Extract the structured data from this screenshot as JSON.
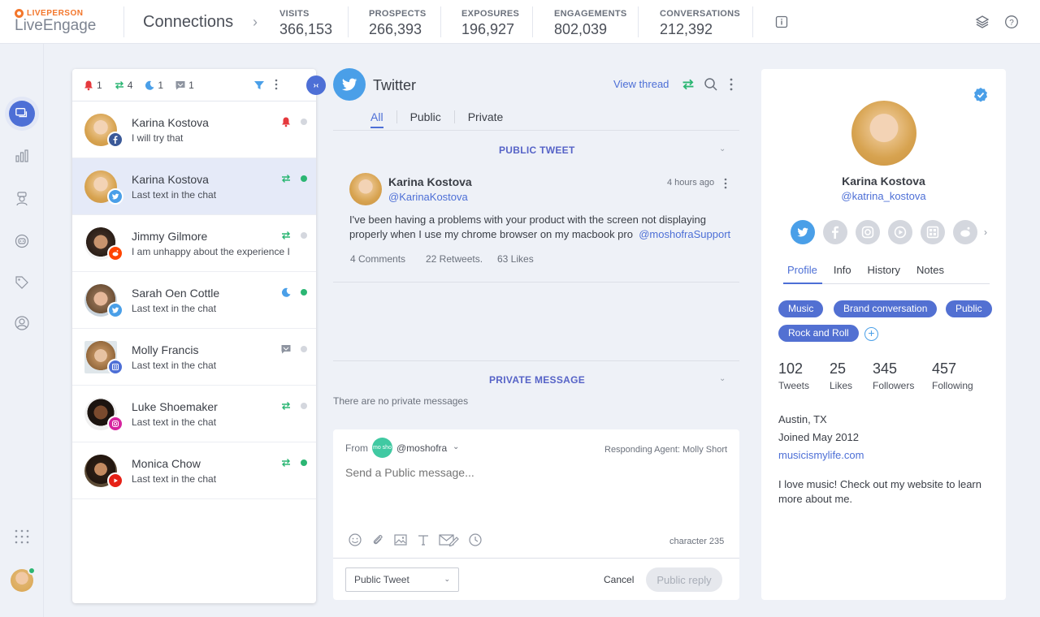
{
  "header": {
    "brand": "LIVEPERSON",
    "product": "LiveEngage",
    "page_title": "Connections",
    "stats": [
      {
        "label": "VISITS",
        "value": "366,153"
      },
      {
        "label": "PROSPECTS",
        "value": "266,393"
      },
      {
        "label": "EXPOSURES",
        "value": "196,927"
      },
      {
        "label": "ENGAGEMENTS",
        "value": "802,039"
      },
      {
        "label": "CONVERSATIONS",
        "value": "212,392"
      }
    ]
  },
  "filters": {
    "alerts": "1",
    "transfers": "4",
    "away": "1",
    "messages": "1"
  },
  "conversations": [
    {
      "name": "Karina Kostova",
      "message": "I will try that",
      "channel": "facebook",
      "status_icon": "alert-bell-icon",
      "online": false
    },
    {
      "name": "Karina Kostova",
      "message": "Last text in the chat",
      "channel": "twitter",
      "status_icon": "transfer-arrows-icon",
      "online": true
    },
    {
      "name": "Jimmy Gilmore",
      "message": "I am unhappy about the experience I",
      "channel": "reddit",
      "status_icon": "transfer-arrows-icon",
      "online": false
    },
    {
      "name": "Sarah Oen Cottle",
      "message": "Last text in the chat",
      "channel": "twitter",
      "status_icon": "moon-icon",
      "online": true
    },
    {
      "name": "Molly Francis",
      "message": "Last text in the chat",
      "channel": "app",
      "status_icon": "message-icon",
      "online": false
    },
    {
      "name": "Luke Shoemaker",
      "message": "Last text in the chat",
      "channel": "instagram",
      "status_icon": "transfer-arrows-icon",
      "online": false
    },
    {
      "name": "Monica Chow",
      "message": "Last text in the chat",
      "channel": "youtube",
      "status_icon": "transfer-arrows-icon",
      "online": true
    }
  ],
  "main": {
    "channel_title": "Twitter",
    "view_thread": "View thread",
    "tabs": [
      "All",
      "Public",
      "Private"
    ],
    "public_section": "PUBLIC TWEET",
    "tweet": {
      "author": "Karina Kostova",
      "handle": "@KarinaKostova",
      "time": "4 hours ago",
      "body": "I've been having a problems with your product with the screen not displaying properly when I use my chrome browser on my macbook pro",
      "mention": "@moshofraSupport",
      "comments": "4 Comments",
      "retweets": "22 Retweets.",
      "likes": "63 Likes"
    },
    "private_section": "PRIVATE MESSAGE",
    "no_private": "There are no private messages"
  },
  "composer": {
    "from_label": "From",
    "logo_text": "mo sho",
    "from_handle": "@moshofra",
    "agent": "Responding Agent: Molly Short",
    "placeholder": "Send a Public message...",
    "char_count": "character 235",
    "type_select": "Public Tweet",
    "cancel": "Cancel",
    "reply": "Public reply"
  },
  "profile": {
    "name": "Karina Kostova",
    "handle": "@katrina_kostova",
    "tabs": [
      "Profile",
      "Info",
      "History",
      "Notes"
    ],
    "tags": [
      "Music",
      "Brand conversation",
      "Public",
      "Rock and Roll"
    ],
    "stats": [
      {
        "value": "102",
        "label": "Tweets"
      },
      {
        "value": "25",
        "label": "Likes"
      },
      {
        "value": "345",
        "label": "Followers"
      },
      {
        "value": "457",
        "label": "Following"
      }
    ],
    "location": "Austin, TX",
    "joined": "Joined May 2012",
    "website": "musicismylife.com",
    "bio": "I love music! Check out my website to learn more about me."
  },
  "colors": {
    "accent": "#4d6fd6",
    "twitter": "#4a9fe8",
    "online": "#2bb673",
    "alert": "#e5393d"
  }
}
